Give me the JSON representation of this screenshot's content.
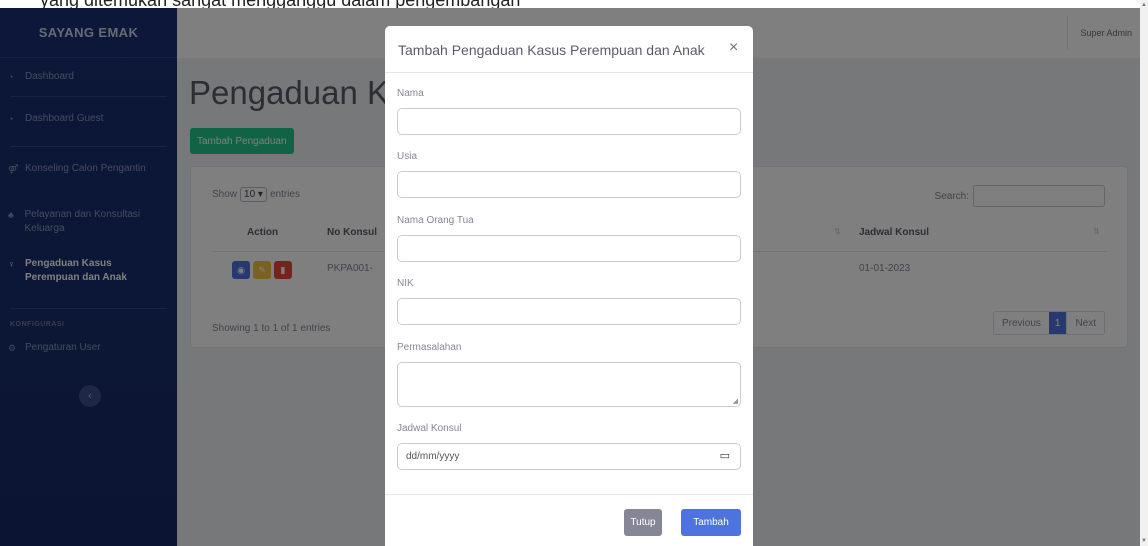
{
  "top_strip": {
    "partial_text": "yang ditemukan sangat mengganggu dalam pengembangan"
  },
  "sidebar": {
    "brand": "SAYANG EMAK",
    "items": [
      {
        "label": "Dashboard",
        "icon": "gauge-icon"
      },
      {
        "label": "Dashboard Guest",
        "icon": "gauge-icon"
      },
      {
        "label": "Konseling Calon Pengantin",
        "icon": "couple-icon"
      },
      {
        "label": "Pelayanan dan Konsultasi Keluarga",
        "icon": "users-icon"
      },
      {
        "label": "Pengaduan Kasus Perempuan dan Anak",
        "icon": "female-icon",
        "active": true
      }
    ],
    "section_heading": "KONFIGURASI",
    "config_items": [
      {
        "label": "Pengaturan User",
        "icon": "cogs-icon"
      }
    ],
    "toggle_icon": "chevron-left-icon"
  },
  "topbar": {
    "user": "Super Admin"
  },
  "page": {
    "title": "Pengaduan Ka",
    "add_button": "Tambah Pengaduan"
  },
  "table": {
    "show_label": "Show",
    "entries_value": "10",
    "entries_label": "entries",
    "search_label": "Search:",
    "headers": [
      "Action",
      "No Konsul",
      "Jadwal Konsul"
    ],
    "rows": [
      {
        "no_konsul": "PKPA001-",
        "jadwal_konsul": "01-01-2023"
      }
    ],
    "showing_text": "Showing 1 to 1 of 1 entries",
    "pagination": {
      "previous": "Previous",
      "current": "1",
      "next": "Next"
    }
  },
  "modal": {
    "title": "Tambah Pengaduan Kasus Perempuan dan Anak",
    "close_symbol": "×",
    "fields": {
      "nama": {
        "label": "Nama",
        "value": ""
      },
      "usia": {
        "label": "Usia",
        "value": ""
      },
      "nama_orang_tua": {
        "label": "Nama Orang Tua",
        "value": ""
      },
      "nik": {
        "label": "NIK",
        "value": ""
      },
      "permasalahan": {
        "label": "Permasalahan",
        "value": ""
      },
      "jadwal_konsul": {
        "label": "Jadwal Konsul",
        "placeholder": "dd/mm/yyyy"
      }
    },
    "buttons": {
      "close": "Tutup",
      "submit": "Tambah"
    }
  },
  "colors": {
    "sidebar": "#1a2f73",
    "primary": "#4e73df",
    "success": "#1cc88a",
    "secondary": "#858796",
    "view_button": "#4e73df",
    "edit_button": "#f6c23e",
    "delete_button": "#e74a3b"
  }
}
